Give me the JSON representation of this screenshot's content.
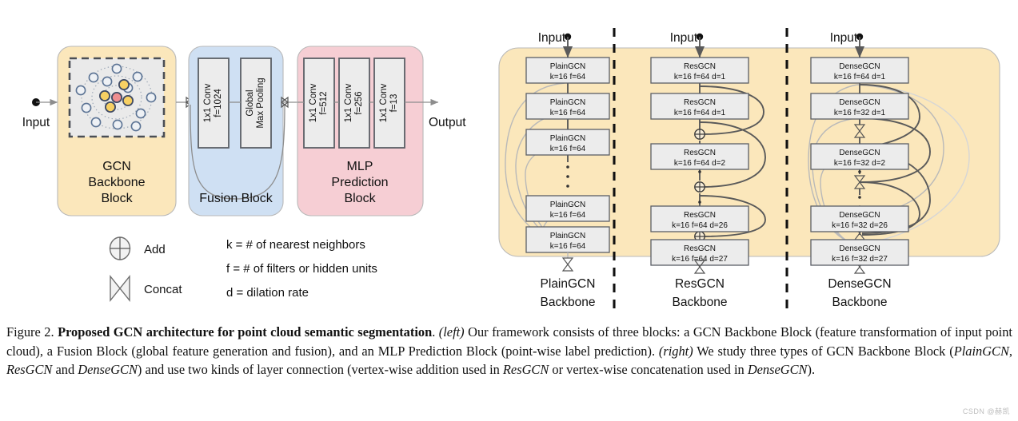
{
  "figure": {
    "left_panel": {
      "input_label": "Input",
      "output_label": "Output",
      "blocks": [
        {
          "name": "gcn-backbone-block",
          "title_lines": [
            "GCN",
            "Backbone",
            "Block"
          ],
          "color": "#fbe7bb"
        },
        {
          "name": "fusion-block",
          "title_lines": [
            "Fusion Block"
          ],
          "color": "#cfe0f3",
          "layers": [
            {
              "l1": "1x1 Conv",
              "l2": "f=1024"
            },
            {
              "l1": "Global",
              "l2": "Max Pooling"
            }
          ]
        },
        {
          "name": "mlp-prediction-block",
          "title_lines": [
            "MLP",
            "Prediction",
            "Block"
          ],
          "color": "#f6ced4",
          "layers": [
            {
              "l1": "1x1 Conv",
              "l2": "f=512"
            },
            {
              "l1": "1x1 Conv",
              "l2": "f=256"
            },
            {
              "l1": "1x1 Conv",
              "l2": "f=13"
            }
          ]
        }
      ]
    },
    "legend": {
      "symbols": [
        {
          "icon": "circle-plus-icon",
          "label": "Add"
        },
        {
          "icon": "bowtie-concat-icon",
          "label": "Concat"
        }
      ],
      "notes": [
        "k = # of nearest neighbors",
        "f = # of filters or hidden units",
        "d = dilation rate"
      ]
    },
    "right_panel": {
      "columns": [
        {
          "name": "plaingcn-backbone",
          "input_label": "Input",
          "caption_lines": [
            "PlainGCN",
            "Backbone"
          ],
          "connection": "none",
          "nodes": [
            {
              "title": "PlainGCN",
              "params": "k=16 f=64"
            },
            {
              "title": "PlainGCN",
              "params": "k=16 f=64"
            },
            {
              "title": "PlainGCN",
              "params": "k=16 f=64"
            },
            {
              "title": "PlainGCN",
              "params": "k=16 f=64"
            },
            {
              "title": "PlainGCN",
              "params": "k=16 f=64"
            }
          ]
        },
        {
          "name": "resgcn-backbone",
          "input_label": "Input",
          "caption_lines": [
            "ResGCN",
            "Backbone"
          ],
          "connection": "add",
          "nodes": [
            {
              "title": "ResGCN",
              "params": "k=16 f=64 d=1"
            },
            {
              "title": "ResGCN",
              "params": "k=16 f=64 d=1"
            },
            {
              "title": "ResGCN",
              "params": "k=16 f=64 d=2"
            },
            {
              "title": "ResGCN",
              "params": "k=16 f=64 d=26"
            },
            {
              "title": "ResGCN",
              "params": "k=16 f=64 d=27"
            }
          ]
        },
        {
          "name": "densegcn-backbone",
          "input_label": "Input",
          "caption_lines": [
            "DenseGCN",
            "Backbone"
          ],
          "connection": "concat",
          "nodes": [
            {
              "title": "DenseGCN",
              "params": "k=16 f=64 d=1"
            },
            {
              "title": "DenseGCN",
              "params": "k=16 f=32 d=1"
            },
            {
              "title": "DenseGCN",
              "params": "k=16 f=32 d=2"
            },
            {
              "title": "DenseGCN",
              "params": "k=16 f=32 d=26"
            },
            {
              "title": "DenseGCN",
              "params": "k=16 f=32 d=27"
            }
          ]
        }
      ]
    },
    "caption": {
      "prefix": "Figure 2. ",
      "bold_title": "Proposed GCN architecture for point cloud semantic segmentation",
      "seg1": ". ",
      "ital1": "(left)",
      "seg2": " Our framework consists of three blocks: a GCN Backbone Block (feature transformation of input point cloud), a Fusion Block (global feature generation and fusion), and an MLP Prediction Block (point-wise label prediction). ",
      "ital2": "(right)",
      "seg3": " We study three types of GCN Backbone Block (",
      "ital3": "PlainGCN",
      "seg4": ", ",
      "ital4": "ResGCN",
      "seg5": " and ",
      "ital5": "DenseGCN",
      "seg6": ") and use two kinds of layer connection (vertex-wise addition used in ",
      "ital6": "ResGCN",
      "seg7": " or vertex-wise concatenation used in ",
      "ital7": "DenseGCN",
      "seg8": ")."
    },
    "watermark": "CSDN @赫凯"
  }
}
